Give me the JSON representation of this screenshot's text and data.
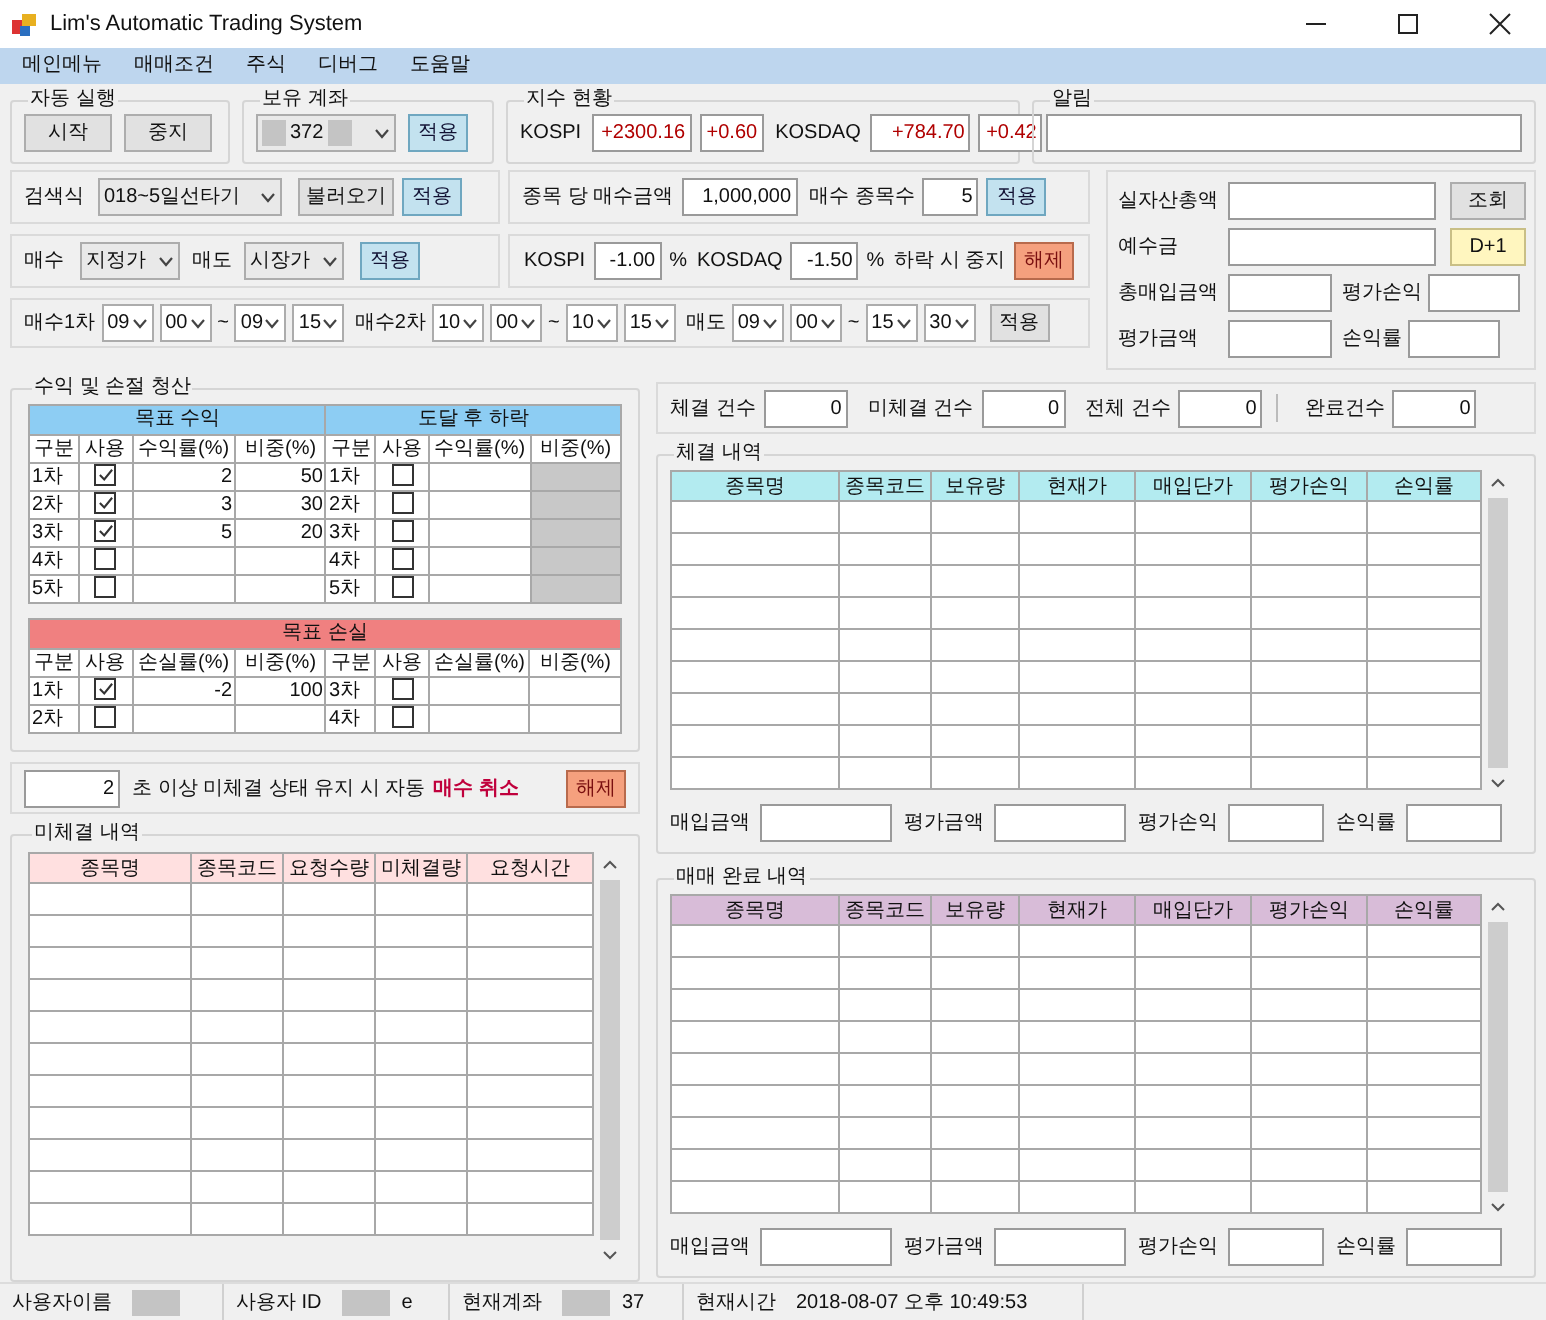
{
  "window": {
    "title": "Lim's Automatic Trading System"
  },
  "menu": [
    "메인메뉴",
    "매매조건",
    "주식",
    "디버그",
    "도움말"
  ],
  "auto_run": {
    "title": "자동 실행",
    "buttons": [
      {
        "text": "시작",
        "kind": "plain"
      },
      {
        "text": "중지",
        "kind": "plain"
      }
    ]
  },
  "account": {
    "title": "보유 계좌",
    "redacted": true,
    "value": "372",
    "apply": {
      "text": "적용",
      "kind": "accent"
    }
  },
  "index_status": {
    "title": "지수 현황",
    "items": [
      {
        "label": "KOSPI",
        "value": "+2300.16",
        "change": "+0.60"
      },
      {
        "label": "KOSDAQ",
        "value": "+784.70",
        "change": "+0.42"
      }
    ]
  },
  "alerts": {
    "title": "알림"
  },
  "search": {
    "label": "검색식",
    "value": "018~5일선타기",
    "load": {
      "text": "불러오기",
      "kind": "plain"
    },
    "apply": {
      "text": "적용",
      "kind": "accent"
    }
  },
  "per_stock": {
    "label": "종목 당 매수금액",
    "value": "1,000,000",
    "count_label": "매수 종목수",
    "count": "5",
    "apply": {
      "text": "적용",
      "kind": "accent"
    }
  },
  "order_type": {
    "buy_label": "매수",
    "buy": "지정가",
    "sell_label": "매도",
    "sell": "시장가",
    "apply": {
      "text": "적용",
      "kind": "accent"
    }
  },
  "drop_stop": {
    "items": [
      {
        "label": "KOSPI",
        "value": "-1.00",
        "unit": "%"
      },
      {
        "label": "KOSDAQ",
        "value": "-1.50",
        "unit": "%"
      }
    ],
    "text": "하락 시 중지",
    "button": {
      "text": "해제",
      "kind": "warning"
    }
  },
  "schedule": {
    "items": [
      {
        "label": "매수1차",
        "from": [
          "09",
          "00"
        ],
        "sep": "~",
        "to": [
          "09",
          "15"
        ]
      },
      {
        "label": "매수2차",
        "from": [
          "10",
          "00"
        ],
        "sep": "~",
        "to": [
          "10",
          "15"
        ]
      },
      {
        "label": "매도",
        "from": [
          "09",
          "00"
        ],
        "sep": "~",
        "to": [
          "15",
          "30"
        ]
      }
    ],
    "apply": {
      "text": "적용",
      "kind": "plain"
    }
  },
  "assets": {
    "rows": [
      [
        {
          "kind": "label",
          "text": "실자산총액"
        },
        {
          "kind": "field"
        },
        {
          "kind": "button",
          "text": "조회"
        }
      ],
      [
        {
          "kind": "label",
          "text": "예수금"
        },
        {
          "kind": "field"
        },
        {
          "kind": "highlight-button",
          "text": "D+1"
        }
      ],
      [
        {
          "kind": "label",
          "text": "총매입금액"
        },
        {
          "kind": "field"
        },
        {
          "kind": "label",
          "text": "평가손익"
        },
        {
          "kind": "field"
        }
      ],
      [
        {
          "kind": "label",
          "text": "평가금액"
        },
        {
          "kind": "field"
        },
        {
          "kind": "label",
          "text": "손익률"
        },
        {
          "kind": "field"
        }
      ]
    ]
  },
  "profit_loss": {
    "title": "수익 및 손절 청산",
    "target_profit": {
      "title": "목표 수익",
      "columns": [
        "구분",
        "사용",
        "수익률(%)",
        "비중(%)"
      ],
      "rows": [
        {
          "stage": "1차",
          "checked": true,
          "rate": "2",
          "weight": "50"
        },
        {
          "stage": "2차",
          "checked": true,
          "rate": "3",
          "weight": "30"
        },
        {
          "stage": "3차",
          "checked": true,
          "rate": "5",
          "weight": "20"
        },
        {
          "stage": "4차",
          "checked": false
        },
        {
          "stage": "5차",
          "checked": false
        }
      ]
    },
    "drop_after": {
      "title": "도달 후 하락",
      "columns": [
        "구분",
        "사용",
        "수익률(%)",
        "비중(%)"
      ],
      "weight_disabled": true,
      "rows": [
        {
          "stage": "1차",
          "checked": false
        },
        {
          "stage": "2차",
          "checked": false
        },
        {
          "stage": "3차",
          "checked": false
        },
        {
          "stage": "4차",
          "checked": false
        },
        {
          "stage": "5차",
          "checked": false
        }
      ]
    },
    "target_loss": {
      "title": "목표 손실",
      "columns": [
        "구분",
        "사용",
        "손실률(%)",
        "비중(%)",
        "구분",
        "사용",
        "손실률(%)",
        "비중(%)"
      ],
      "rows": [
        {
          "left": {
            "stage": "1차",
            "checked": true,
            "rate": "-2",
            "weight": "100"
          },
          "right": {
            "stage": "3차",
            "checked": false
          }
        },
        {
          "left": {
            "stage": "2차",
            "checked": false
          },
          "right": {
            "stage": "4차",
            "checked": false
          }
        }
      ]
    }
  },
  "cancel": {
    "seconds": "2",
    "text": "초 이상 미체결 상태 유지 시 자동",
    "highlight": "매수 취소",
    "button": {
      "text": "해제",
      "kind": "warning"
    }
  },
  "pending": {
    "title": "미체결 내역",
    "columns": [
      "종목명",
      "종목코드",
      "요청수량",
      "미체결량",
      "요청시간"
    ]
  },
  "counts": [
    {
      "label": "체결 건수",
      "value": "0"
    },
    {
      "label": "미체결 건수",
      "value": "0"
    },
    {
      "label": "전체 건수",
      "value": "0"
    },
    {
      "label": "완료건수",
      "value": "0"
    }
  ],
  "filled": {
    "title": "체결 내역",
    "columns": [
      "종목명",
      "종목코드",
      "보유량",
      "현재가",
      "매입단가",
      "평가손익",
      "손익률"
    ],
    "footer": [
      "매입금액",
      "평가금액",
      "평가손익",
      "손익률"
    ]
  },
  "completed": {
    "title": "매매 완료 내역",
    "columns": [
      "종목명",
      "종목코드",
      "보유량",
      "현재가",
      "매입단가",
      "평가손익",
      "손익률"
    ],
    "footer": [
      "매입금액",
      "평가금액",
      "평가손익",
      "손익률"
    ]
  },
  "status_bar": [
    {
      "label": "사용자이름",
      "redacted": true
    },
    {
      "label": "사용자 ID",
      "redacted": true,
      "value": "e"
    },
    {
      "label": "현재계좌",
      "redacted": true,
      "value": "37"
    },
    {
      "label": "현재시간",
      "value": "2018-08-07 오후 10:49:53"
    }
  ]
}
